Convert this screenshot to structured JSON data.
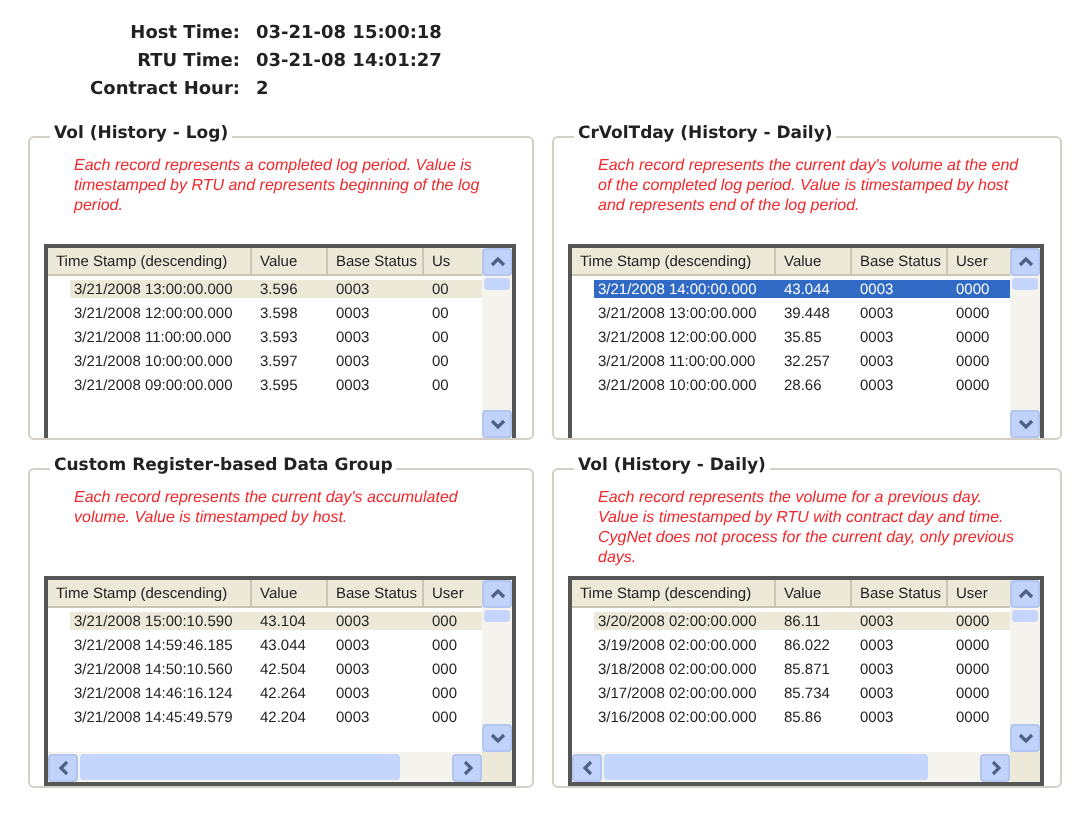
{
  "header": [
    {
      "label": "Host Time:",
      "value": "03-21-08 15:00:18"
    },
    {
      "label": "RTU Time:",
      "value": "03-21-08 14:01:27"
    },
    {
      "label": "Contract Hour:",
      "value": "2"
    }
  ],
  "panels": [
    {
      "title": "Vol (History - Log)",
      "description": "Each record represents a completed log period. Value is timestamped by RTU and represents beginning of the log period.",
      "focused": false,
      "horizontal_scrollbar": false,
      "columns": [
        "Time Stamp  (descending)",
        "Value",
        "Base Status",
        "Us"
      ],
      "rows": [
        {
          "cells": [
            "3/21/2008 13:00:00.000",
            "3.596",
            "0003",
            "00"
          ],
          "selected": true
        },
        {
          "cells": [
            "3/21/2008 12:00:00.000",
            "3.598",
            "0003",
            "00"
          ],
          "selected": false
        },
        {
          "cells": [
            "3/21/2008 11:00:00.000",
            "3.593",
            "0003",
            "00"
          ],
          "selected": false
        },
        {
          "cells": [
            "3/21/2008 10:00:00.000",
            "3.597",
            "0003",
            "00"
          ],
          "selected": false
        },
        {
          "cells": [
            "3/21/2008 09:00:00.000",
            "3.595",
            "0003",
            "00"
          ],
          "selected": false
        }
      ]
    },
    {
      "title": "CrVolTday (History - Daily)",
      "description": "Each record represents the current day's volume at the end of the completed log period. Value is timestamped by host and represents end of the log period.",
      "focused": true,
      "horizontal_scrollbar": false,
      "columns": [
        "Time Stamp  (descending)",
        "Value",
        "Base Status",
        "User"
      ],
      "rows": [
        {
          "cells": [
            "3/21/2008 14:00:00.000",
            "43.044",
            "0003",
            "0000"
          ],
          "selected": true
        },
        {
          "cells": [
            "3/21/2008 13:00:00.000",
            "39.448",
            "0003",
            "0000"
          ],
          "selected": false
        },
        {
          "cells": [
            "3/21/2008 12:00:00.000",
            "35.85",
            "0003",
            "0000"
          ],
          "selected": false
        },
        {
          "cells": [
            "3/21/2008 11:00:00.000",
            "32.257",
            "0003",
            "0000"
          ],
          "selected": false
        },
        {
          "cells": [
            "3/21/2008 10:00:00.000",
            "28.66",
            "0003",
            "0000"
          ],
          "selected": false
        }
      ]
    },
    {
      "title": "Custom Register-based Data Group",
      "description": "Each record represents the current day's accumulated volume. Value is timestamped by host.",
      "focused": false,
      "horizontal_scrollbar": true,
      "columns": [
        "Time Stamp  (descending)",
        "Value",
        "Base Status",
        "User"
      ],
      "rows": [
        {
          "cells": [
            "3/21/2008 15:00:10.590",
            "43.104",
            "0003",
            "000"
          ],
          "selected": true
        },
        {
          "cells": [
            "3/21/2008 14:59:46.185",
            "43.044",
            "0003",
            "000"
          ],
          "selected": false
        },
        {
          "cells": [
            "3/21/2008 14:50:10.560",
            "42.504",
            "0003",
            "000"
          ],
          "selected": false
        },
        {
          "cells": [
            "3/21/2008 14:46:16.124",
            "42.264",
            "0003",
            "000"
          ],
          "selected": false
        },
        {
          "cells": [
            "3/21/2008 14:45:49.579",
            "42.204",
            "0003",
            "000"
          ],
          "selected": false
        }
      ]
    },
    {
      "title": "Vol (History - Daily)",
      "description": "Each record represents the volume for a previous day. Value is timestamped by RTU with contract day and time. CygNet does not process for the current day, only previous days.",
      "focused": false,
      "horizontal_scrollbar": true,
      "columns": [
        "Time Stamp  (descending)",
        "Value",
        "Base Status",
        "User"
      ],
      "rows": [
        {
          "cells": [
            "3/20/2008 02:00:00.000",
            "86.11",
            "0003",
            "0000"
          ],
          "selected": true
        },
        {
          "cells": [
            "3/19/2008 02:00:00.000",
            "86.022",
            "0003",
            "0000"
          ],
          "selected": false
        },
        {
          "cells": [
            "3/18/2008 02:00:00.000",
            "85.871",
            "0003",
            "0000"
          ],
          "selected": false
        },
        {
          "cells": [
            "3/17/2008 02:00:00.000",
            "85.734",
            "0003",
            "0000"
          ],
          "selected": false
        },
        {
          "cells": [
            "3/16/2008 02:00:00.000",
            "85.86",
            "0003",
            "0000"
          ],
          "selected": false
        }
      ]
    }
  ]
}
